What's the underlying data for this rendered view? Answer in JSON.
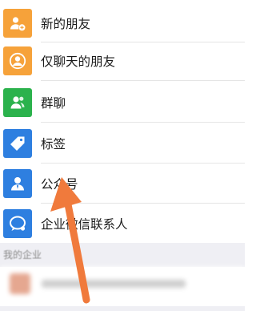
{
  "contacts": {
    "items": [
      {
        "label": "新的朋友",
        "icon": "add-friend-icon",
        "color": "#F6A23A"
      },
      {
        "label": "仅聊天的朋友",
        "icon": "chat-only-friend-icon",
        "color": "#F6A23A"
      },
      {
        "label": "群聊",
        "icon": "group-chat-icon",
        "color": "#2BB24C"
      },
      {
        "label": "标签",
        "icon": "tag-icon",
        "color": "#2E7FE0"
      },
      {
        "label": "公众号",
        "icon": "official-account-icon",
        "color": "#2E7FE0"
      },
      {
        "label": "企业微信联系人",
        "icon": "wecom-contact-icon",
        "color": "#2E7FE0"
      }
    ]
  },
  "section": {
    "title": "我的企业"
  },
  "annotation": {
    "arrow_color": "#F07A3C",
    "arrow_icon": "pointer-arrow-icon"
  }
}
